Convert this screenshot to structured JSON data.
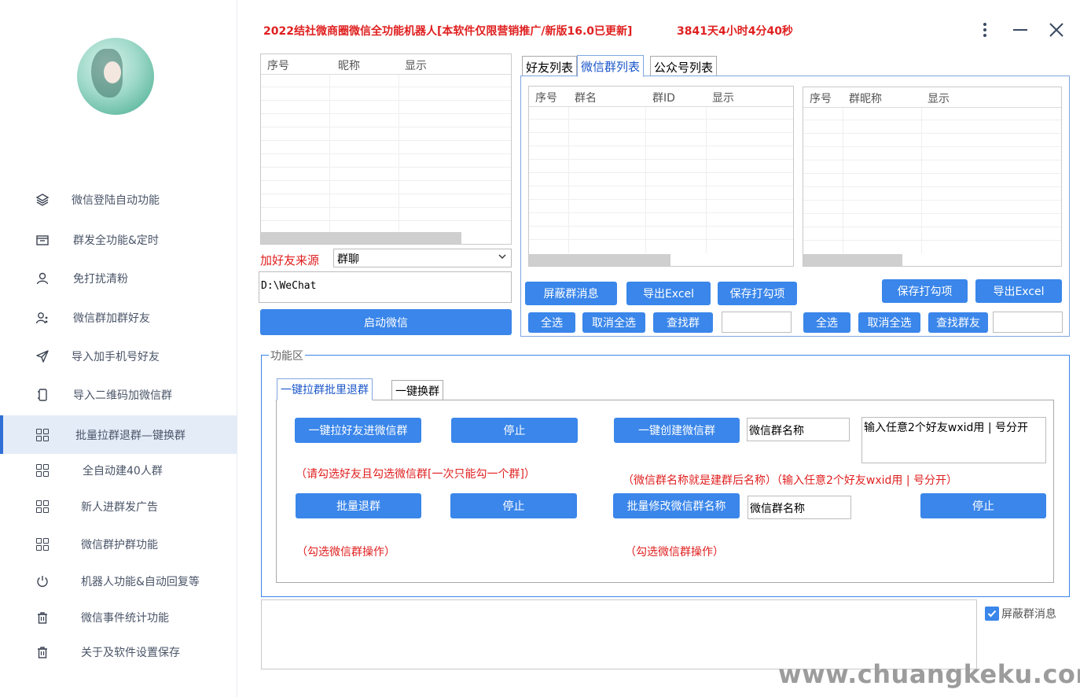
{
  "header": {
    "title": "2022结社微商圈微信全功能机器人[本软件仅限营销推广/新版16.0已更新]",
    "uptime": "3841天4小时4分40秒",
    "more_icon": "more-vertical-icon",
    "minimize_icon": "minimize-icon",
    "close_icon": "close-icon"
  },
  "sidebar": {
    "items": [
      {
        "label": "微信登陆自动功能",
        "icon": "layers-icon"
      },
      {
        "label": "群发全功能&定时",
        "icon": "folder-icon"
      },
      {
        "label": "免打扰清粉",
        "icon": "user-icon"
      },
      {
        "label": "微信群加群好友",
        "icon": "users-icon"
      },
      {
        "label": "导入加手机号好友",
        "icon": "send-icon"
      },
      {
        "label": "导入二维码加微信群",
        "icon": "phone-icon"
      },
      {
        "label": "批量拉群退群—键换群",
        "icon": "grid-icon",
        "active": true
      },
      {
        "label": "全自动建40人群",
        "icon": "grid-icon"
      },
      {
        "label": "新人进群发广告",
        "icon": "grid-icon"
      },
      {
        "label": "微信群护群功能",
        "icon": "grid-icon"
      },
      {
        "label": "机器人功能&自动回复等",
        "icon": "power-icon"
      },
      {
        "label": "微信事件统计功能",
        "icon": "trash-icon"
      },
      {
        "label": "关于及软件设置保存",
        "icon": "trash-icon"
      }
    ]
  },
  "friend_list": {
    "columns": [
      "序号",
      "昵称",
      "显示"
    ]
  },
  "source": {
    "label": "加好友来源",
    "value": "群聊",
    "path": "D:\\WeChat",
    "start_button": "启动微信"
  },
  "tabs": [
    "好友列表",
    "微信群列表",
    "公众号列表"
  ],
  "group_list": {
    "columns": [
      "序号",
      "群名",
      "群ID",
      "显示"
    ],
    "buttons": {
      "block": "屏蔽群消息",
      "export": "导出Excel",
      "save": "保存打勾项",
      "select_all": "全选",
      "deselect": "取消全选",
      "find": "查找群"
    }
  },
  "member_list": {
    "columns": [
      "序号",
      "群昵称",
      "显示"
    ],
    "buttons": {
      "save": "保存打勾项",
      "export": "导出Excel",
      "select_all": "全选",
      "deselect": "取消全选",
      "find": "查找群友"
    }
  },
  "function_area": {
    "legend": "功能区",
    "tabs": [
      "一键拉群批里退群",
      "一键换群"
    ],
    "pull_button": "一键拉好友进微信群",
    "stop1": "停止",
    "create_button": "一键创建微信群",
    "group_name_field": "微信群名称",
    "wxid_field": "输入任意2个好友wxid用 | 号分开",
    "note_pull": "（请勾选好友且勾选微信群[一次只能勾一个群]）",
    "note_create": "（微信群名称就是建群后名称）（输入任意2个好友wxid用 | 号分开）",
    "quit_button": "批量退群",
    "stop2": "停止",
    "rename_button": "批量修改微信群名称",
    "rename_field": "微信群名称",
    "stop3": "停止",
    "note_quit": "（勾选微信群操作）",
    "note_rename": "（勾选微信群操作）"
  },
  "log": {
    "checkbox_label": "屏蔽群消息",
    "checkbox_checked": true
  },
  "watermark": "www.chuangkeku.com",
  "colors": {
    "accent": "#3a86ea",
    "title_red": "#e02020",
    "active_nav": "#e4ecf8"
  }
}
